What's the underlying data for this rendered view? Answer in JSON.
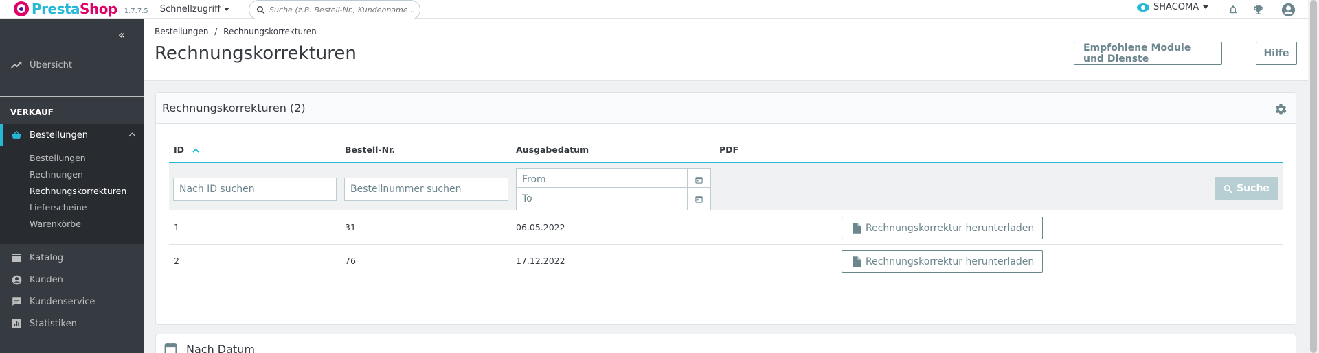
{
  "topbar": {
    "logo_text_a": "Presta",
    "logo_text_b": "Shop",
    "version": "1.7.7.5",
    "quick_access": "Schnellzugriff",
    "search_placeholder": "Suche (z.B. Bestell-Nr., Kundenname ...)",
    "shop_name": "SHACOMA"
  },
  "sidebar": {
    "overview": "Übersicht",
    "section": "VERKAUF",
    "orders": "Bestellungen",
    "sub": [
      "Bestellungen",
      "Rechnungen",
      "Rechnungskorrekturen",
      "Lieferscheine",
      "Warenkörbe"
    ],
    "catalog": "Katalog",
    "customers": "Kunden",
    "service": "Kundenservice",
    "stats": "Statistiken"
  },
  "header": {
    "breadcrumb_parent": "Bestellungen",
    "breadcrumb_sep": "/",
    "breadcrumb_current": "Rechnungskorrekturen",
    "title": "Rechnungskorrekturen",
    "btn_modules": "Empfohlene Module und Dienste",
    "btn_help": "Hilfe"
  },
  "grid": {
    "title": "Rechnungskorrekturen (2)",
    "columns": [
      "ID",
      "Bestell-Nr.",
      "Ausgabedatum",
      "PDF"
    ],
    "filter_id_placeholder": "Nach ID suchen",
    "filter_order_placeholder": "Bestellnummer suchen",
    "filter_from": "From",
    "filter_to": "To",
    "search_button": "Suche",
    "rows": [
      {
        "id": "1",
        "order": "31",
        "date": "06.05.2022",
        "pdf": "Rechnungskorrektur herunterladen"
      },
      {
        "id": "2",
        "order": "76",
        "date": "17.12.2022",
        "pdf": "Rechnungskorrektur herunterladen"
      }
    ]
  },
  "by_date": {
    "title": "Nach Datum"
  },
  "colors": {
    "accent": "#25b9d7",
    "brand": "#df0067",
    "sidebar": "#363a41"
  }
}
